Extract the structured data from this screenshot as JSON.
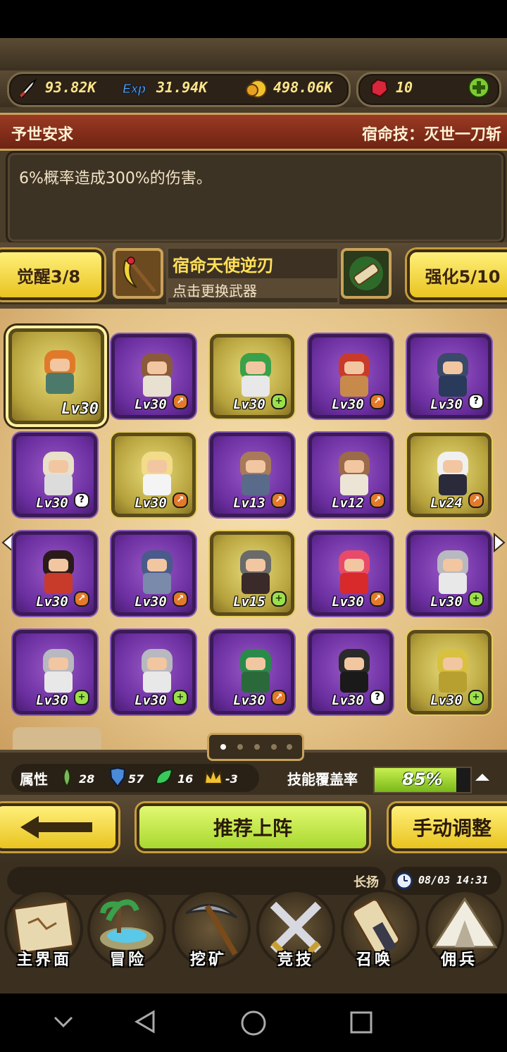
{
  "resources": {
    "attack": "93.82K",
    "exp_icon_label": "Exp",
    "exp": "31.94K",
    "gold": "498.06K",
    "gems": "10"
  },
  "skill_bar": {
    "title": "予世安求",
    "fate_skill": "宿命技：灭世一刀斩",
    "description": "6%概率造成300%的伤害。"
  },
  "weapon": {
    "awaken_label": "觉醒3/8",
    "name": "宿命天使逆刃",
    "hint": "点击更换武器",
    "enhance_label": "强化5/10"
  },
  "heroes": [
    {
      "lv": "Lv30",
      "frame": "gold",
      "badge": "",
      "hair": "#e07a2a",
      "cloth": "#4b7a6a",
      "selected": true
    },
    {
      "lv": "Lv30",
      "frame": "purple",
      "badge": "dn",
      "hair": "#8a5a3a",
      "cloth": "#e8e0d0"
    },
    {
      "lv": "Lv30",
      "frame": "gold",
      "badge": "plus",
      "hair": "#3aa04a",
      "cloth": "#e8e8e8"
    },
    {
      "lv": "Lv30",
      "frame": "purple",
      "badge": "dn",
      "hair": "#c83a2a",
      "cloth": "#c88a4a"
    },
    {
      "lv": "Lv30",
      "frame": "purple",
      "badge": "q",
      "hair": "#3a4a6a",
      "cloth": "#2a3a5a"
    },
    {
      "lv": "Lv30",
      "frame": "purple",
      "badge": "q",
      "hair": "#e8e0c8",
      "cloth": "#dcdcdc"
    },
    {
      "lv": "Lv30",
      "frame": "gold",
      "badge": "dn",
      "hair": "#f2dc8a",
      "cloth": "#f4f4f4"
    },
    {
      "lv": "Lv13",
      "frame": "purple",
      "badge": "dn",
      "hair": "#a87a5a",
      "cloth": "#5a6a8a"
    },
    {
      "lv": "Lv12",
      "frame": "purple",
      "badge": "dn",
      "hair": "#9a6a4a",
      "cloth": "#ece4d4"
    },
    {
      "lv": "Lv24",
      "frame": "gold",
      "badge": "dn",
      "hair": "#f0f0f0",
      "cloth": "#2a2a3a"
    },
    {
      "lv": "Lv30",
      "frame": "purple",
      "badge": "dn",
      "hair": "#2a1a1a",
      "cloth": "#c83a2a"
    },
    {
      "lv": "Lv30",
      "frame": "purple",
      "badge": "dn",
      "hair": "#4a5a8a",
      "cloth": "#7a8aaa"
    },
    {
      "lv": "Lv15",
      "frame": "gold",
      "badge": "plus",
      "hair": "#6a6a6a",
      "cloth": "#3a2a2a"
    },
    {
      "lv": "Lv30",
      "frame": "purple",
      "badge": "dn",
      "hair": "#e84a6a",
      "cloth": "#d82a2a"
    },
    {
      "lv": "Lv30",
      "frame": "purple",
      "badge": "plus",
      "hair": "#b8b8c0",
      "cloth": "#e8e8e8"
    },
    {
      "lv": "Lv30",
      "frame": "purple",
      "badge": "plus",
      "hair": "#b8b8c0",
      "cloth": "#e8e8e8"
    },
    {
      "lv": "Lv30",
      "frame": "purple",
      "badge": "plus",
      "hair": "#b8b8c0",
      "cloth": "#e8e8e8"
    },
    {
      "lv": "Lv30",
      "frame": "purple",
      "badge": "dn",
      "hair": "#2a8a4a",
      "cloth": "#2a6a3a"
    },
    {
      "lv": "Lv30",
      "frame": "purple",
      "badge": "q",
      "hair": "#2a2a2a",
      "cloth": "#1a1a1a"
    },
    {
      "lv": "Lv30",
      "frame": "gold",
      "badge": "plus",
      "hair": "#d8c040",
      "cloth": "#b8a030"
    }
  ],
  "attributes": {
    "label": "属性",
    "a1": "28",
    "a2": "57",
    "a3": "16",
    "a4": "-3",
    "coverage_label": "技能覆盖率",
    "coverage": "85%",
    "coverage_fraction": 0.85
  },
  "actions": {
    "recommend": "推荐上阵",
    "manual": "手动调整"
  },
  "chat": {
    "name": "长扬",
    "datetime": "08/03 14:31"
  },
  "nav": [
    {
      "label": "主界面"
    },
    {
      "label": "冒险"
    },
    {
      "label": "挖矿"
    },
    {
      "label": "竞技"
    },
    {
      "label": "召唤"
    },
    {
      "label": "佣兵"
    }
  ],
  "colors": {
    "accent_yellow": "#ffe05a",
    "green_button": "#b8e040",
    "purple_frame": "#6a2e9e",
    "gold_frame": "#b6a23c"
  }
}
